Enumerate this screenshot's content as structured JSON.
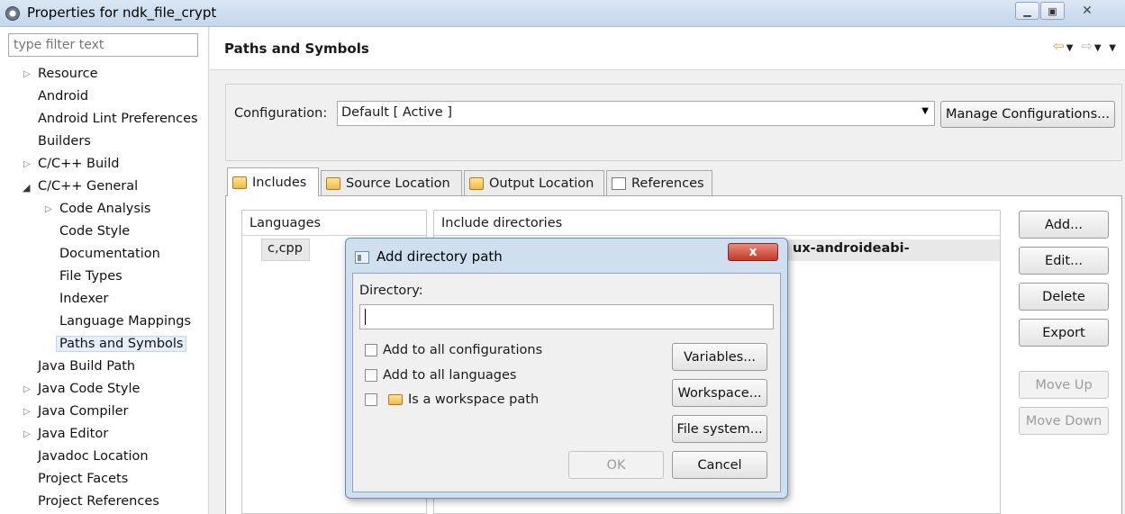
{
  "window": {
    "title": "Properties for ndk_file_crypt"
  },
  "filter": {
    "placeholder": "type filter text"
  },
  "tree": {
    "resource": "Resource",
    "android": "Android",
    "android_lint": "Android Lint Preferences",
    "builders": "Builders",
    "cpp_build": "C/C++ Build",
    "cpp_general": "C/C++ General",
    "code_analysis": "Code Analysis",
    "code_style": "Code Style",
    "documentation": "Documentation",
    "file_types": "File Types",
    "indexer": "Indexer",
    "language_mappings": "Language Mappings",
    "paths_symbols": "Paths and Symbols",
    "java_build_path": "Java Build Path",
    "java_code_style": "Java Code Style",
    "java_compiler": "Java Compiler",
    "java_editor": "Java Editor",
    "javadoc_location": "Javadoc Location",
    "project_facets": "Project Facets",
    "project_references": "Project References"
  },
  "page": {
    "title": "Paths and Symbols"
  },
  "config": {
    "label": "Configuration:",
    "value": "Default  [ Active ]",
    "manage_button": "Manage Configurations..."
  },
  "tabs": {
    "includes": "Includes",
    "source_location": "Source Location",
    "output_location": "Output Location",
    "references": "References"
  },
  "table": {
    "languages_header": "Languages",
    "include_dirs_header": "Include directories",
    "language_cell": "c,cpp",
    "include_row_text": "ux-androideabi-"
  },
  "side_buttons": {
    "add": "Add...",
    "edit": "Edit...",
    "delete": "Delete",
    "export": "Export",
    "move_up": "Move Up",
    "move_down": "Move Down"
  },
  "dialog": {
    "title": "Add directory path",
    "close": "x",
    "directory_label": "Directory:",
    "directory_value": "",
    "add_all_configs": "Add to all configurations",
    "add_all_languages": "Add to all languages",
    "workspace_path": "Is a workspace path",
    "variables": "Variables...",
    "workspace": "Workspace...",
    "file_system": "File system...",
    "ok": "OK",
    "cancel": "Cancel"
  }
}
